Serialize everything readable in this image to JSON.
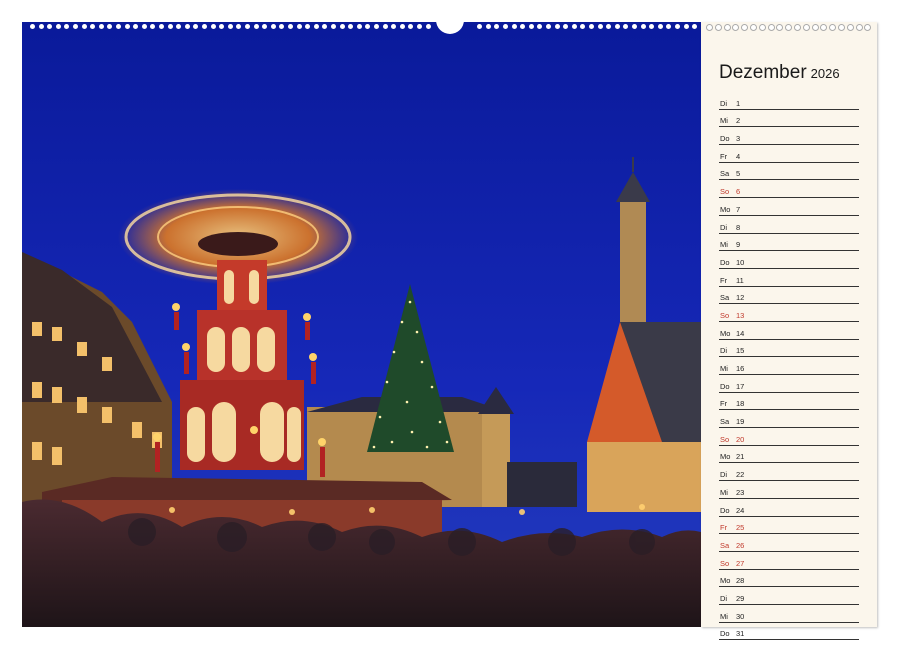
{
  "calendar": {
    "month": "Dezember",
    "year": "2026",
    "colors": {
      "sky": "#0f1fa8",
      "holiday": "#c0392b",
      "panel": "#fbf6ec"
    },
    "days": [
      {
        "wd": "Di",
        "d": "1",
        "red": false
      },
      {
        "wd": "Mi",
        "d": "2",
        "red": false
      },
      {
        "wd": "Do",
        "d": "3",
        "red": false
      },
      {
        "wd": "Fr",
        "d": "4",
        "red": false
      },
      {
        "wd": "Sa",
        "d": "5",
        "red": false
      },
      {
        "wd": "So",
        "d": "6",
        "red": true
      },
      {
        "wd": "Mo",
        "d": "7",
        "red": false
      },
      {
        "wd": "Di",
        "d": "8",
        "red": false
      },
      {
        "wd": "Mi",
        "d": "9",
        "red": false
      },
      {
        "wd": "Do",
        "d": "10",
        "red": false
      },
      {
        "wd": "Fr",
        "d": "11",
        "red": false
      },
      {
        "wd": "Sa",
        "d": "12",
        "red": false
      },
      {
        "wd": "So",
        "d": "13",
        "red": true
      },
      {
        "wd": "Mo",
        "d": "14",
        "red": false
      },
      {
        "wd": "Di",
        "d": "15",
        "red": false
      },
      {
        "wd": "Mi",
        "d": "16",
        "red": false
      },
      {
        "wd": "Do",
        "d": "17",
        "red": false
      },
      {
        "wd": "Fr",
        "d": "18",
        "red": false
      },
      {
        "wd": "Sa",
        "d": "19",
        "red": false
      },
      {
        "wd": "So",
        "d": "20",
        "red": true
      },
      {
        "wd": "Mo",
        "d": "21",
        "red": false
      },
      {
        "wd": "Di",
        "d": "22",
        "red": false
      },
      {
        "wd": "Mi",
        "d": "23",
        "red": false
      },
      {
        "wd": "Do",
        "d": "24",
        "red": false
      },
      {
        "wd": "Fr",
        "d": "25",
        "red": true
      },
      {
        "wd": "Sa",
        "d": "26",
        "red": true
      },
      {
        "wd": "So",
        "d": "27",
        "red": true
      },
      {
        "wd": "Mo",
        "d": "28",
        "red": false
      },
      {
        "wd": "Di",
        "d": "29",
        "red": false
      },
      {
        "wd": "Mi",
        "d": "30",
        "red": false
      },
      {
        "wd": "Do",
        "d": "31",
        "red": false
      }
    ]
  }
}
